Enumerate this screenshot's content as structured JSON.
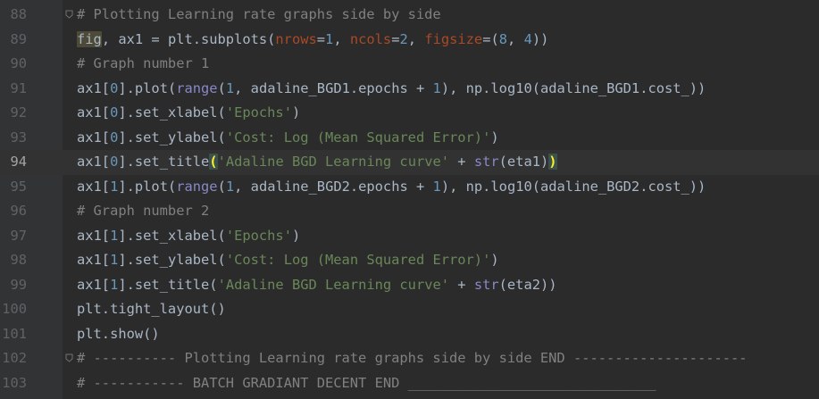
{
  "editor": {
    "first_line": 88,
    "current_line": 94,
    "lines": [
      {
        "number": "88",
        "fold": true,
        "tokens": [
          {
            "type": "comment",
            "text": "# Plotting Learning rate graphs side by side"
          }
        ]
      },
      {
        "number": "89",
        "tokens": [
          {
            "type": "hlvar",
            "text": "fig"
          },
          {
            "type": "plain",
            "text": ", ax1 = plt.subplots("
          },
          {
            "type": "kwarg",
            "text": "nrows"
          },
          {
            "type": "plain",
            "text": "="
          },
          {
            "type": "number",
            "text": "1"
          },
          {
            "type": "plain",
            "text": ", "
          },
          {
            "type": "kwarg",
            "text": "ncols"
          },
          {
            "type": "plain",
            "text": "="
          },
          {
            "type": "number",
            "text": "2"
          },
          {
            "type": "plain",
            "text": ", "
          },
          {
            "type": "kwarg",
            "text": "figsize"
          },
          {
            "type": "plain",
            "text": "=("
          },
          {
            "type": "number",
            "text": "8"
          },
          {
            "type": "plain",
            "text": ", "
          },
          {
            "type": "number",
            "text": "4"
          },
          {
            "type": "plain",
            "text": "))"
          }
        ]
      },
      {
        "number": "90",
        "tokens": [
          {
            "type": "comment",
            "text": "# Graph number 1"
          }
        ]
      },
      {
        "number": "91",
        "tokens": [
          {
            "type": "plain",
            "text": "ax1["
          },
          {
            "type": "number",
            "text": "0"
          },
          {
            "type": "plain",
            "text": "].plot("
          },
          {
            "type": "builtin",
            "text": "range"
          },
          {
            "type": "plain",
            "text": "("
          },
          {
            "type": "number",
            "text": "1"
          },
          {
            "type": "plain",
            "text": ", adaline_BGD1.epochs + "
          },
          {
            "type": "number",
            "text": "1"
          },
          {
            "type": "plain",
            "text": "), np.log10(adaline_BGD1.cost_))"
          }
        ]
      },
      {
        "number": "92",
        "tokens": [
          {
            "type": "plain",
            "text": "ax1["
          },
          {
            "type": "number",
            "text": "0"
          },
          {
            "type": "plain",
            "text": "].set_xlabel("
          },
          {
            "type": "string",
            "text": "'Epochs'"
          },
          {
            "type": "plain",
            "text": ")"
          }
        ]
      },
      {
        "number": "93",
        "tokens": [
          {
            "type": "plain",
            "text": "ax1["
          },
          {
            "type": "number",
            "text": "0"
          },
          {
            "type": "plain",
            "text": "].set_ylabel("
          },
          {
            "type": "string",
            "text": "'Cost: Log (Mean Squared Error)'"
          },
          {
            "type": "plain",
            "text": ")"
          }
        ]
      },
      {
        "number": "94",
        "tokens": [
          {
            "type": "plain",
            "text": "ax1["
          },
          {
            "type": "number",
            "text": "0"
          },
          {
            "type": "plain",
            "text": "].set_title"
          },
          {
            "type": "brace",
            "text": "("
          },
          {
            "type": "string",
            "text": "'Adaline BGD Learning curve'"
          },
          {
            "type": "plain",
            "text": " + "
          },
          {
            "type": "builtin",
            "text": "str"
          },
          {
            "type": "plain",
            "text": "(eta1)"
          },
          {
            "type": "brace",
            "text": ")"
          }
        ]
      },
      {
        "number": "95",
        "tokens": [
          {
            "type": "plain",
            "text": "ax1["
          },
          {
            "type": "number",
            "text": "1"
          },
          {
            "type": "plain",
            "text": "].plot("
          },
          {
            "type": "builtin",
            "text": "range"
          },
          {
            "type": "plain",
            "text": "("
          },
          {
            "type": "number",
            "text": "1"
          },
          {
            "type": "plain",
            "text": ", adaline_BGD2.epochs + "
          },
          {
            "type": "number",
            "text": "1"
          },
          {
            "type": "plain",
            "text": "), np.log10(adaline_BGD2.cost_))"
          }
        ]
      },
      {
        "number": "96",
        "tokens": [
          {
            "type": "comment",
            "text": "# Graph number 2"
          }
        ]
      },
      {
        "number": "97",
        "tokens": [
          {
            "type": "plain",
            "text": "ax1["
          },
          {
            "type": "number",
            "text": "1"
          },
          {
            "type": "plain",
            "text": "].set_xlabel("
          },
          {
            "type": "string",
            "text": "'Epochs'"
          },
          {
            "type": "plain",
            "text": ")"
          }
        ]
      },
      {
        "number": "98",
        "tokens": [
          {
            "type": "plain",
            "text": "ax1["
          },
          {
            "type": "number",
            "text": "1"
          },
          {
            "type": "plain",
            "text": "].set_ylabel("
          },
          {
            "type": "string",
            "text": "'Cost: Log (Mean Squared Error)'"
          },
          {
            "type": "plain",
            "text": ")"
          }
        ]
      },
      {
        "number": "99",
        "tokens": [
          {
            "type": "plain",
            "text": "ax1["
          },
          {
            "type": "number",
            "text": "1"
          },
          {
            "type": "plain",
            "text": "].set_title("
          },
          {
            "type": "string",
            "text": "'Adaline BGD Learning curve'"
          },
          {
            "type": "plain",
            "text": " + "
          },
          {
            "type": "builtin",
            "text": "str"
          },
          {
            "type": "plain",
            "text": "(eta2))"
          }
        ]
      },
      {
        "number": "100",
        "tokens": [
          {
            "type": "plain",
            "text": "plt.tight_layout()"
          }
        ]
      },
      {
        "number": "101",
        "tokens": [
          {
            "type": "plain",
            "text": "plt.show()"
          }
        ]
      },
      {
        "number": "102",
        "fold": true,
        "tokens": [
          {
            "type": "comment",
            "text": "# ---------- Plotting Learning rate graphs side by side END ---------------------"
          }
        ]
      },
      {
        "number": "103",
        "tokens": [
          {
            "type": "comment",
            "text": "# ----------- BATCH GRADIANT DECENT END ______________________________"
          }
        ]
      }
    ]
  },
  "colors": {
    "background": "#2b2b2b",
    "gutter": "#313335",
    "current_line": "#323232",
    "line_number": "#606366",
    "plain": "#a9b7c6",
    "comment": "#808080",
    "builtin": "#8888c6",
    "kwarg": "#aa4926",
    "number": "#6897bb",
    "string": "#6a8759",
    "brace_match": "#ffef28"
  },
  "icons": {
    "fold_marker": "fold-icon"
  }
}
